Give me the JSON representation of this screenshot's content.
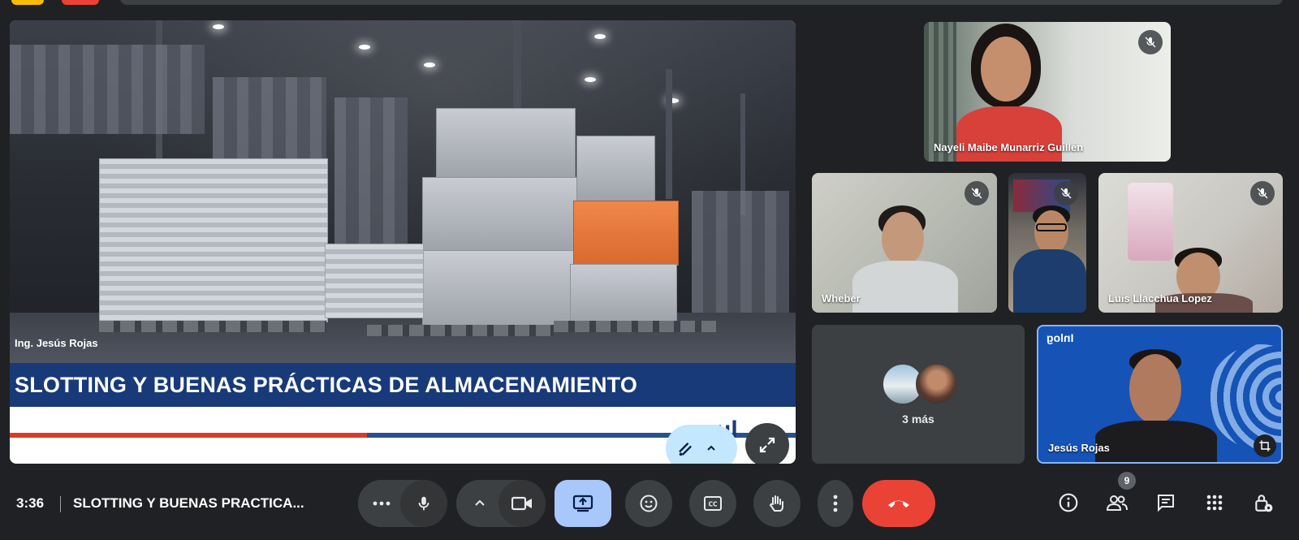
{
  "slide": {
    "presenter_caption": "Ing. Jesús Rojas",
    "title": "SLOTTING Y BUENAS PRÁCTICAS DE ALMACENAMIENTO"
  },
  "participants": [
    {
      "name": "Nayeli Maibe Munarriz Guillén",
      "muted": true
    },
    {
      "name": "Wheber",
      "muted": true
    },
    {
      "name": "",
      "muted": true
    },
    {
      "name": "Luis Llacchua Lopez",
      "muted": true
    },
    {
      "name": "Jesús Rojas",
      "muted": false
    }
  ],
  "overflow_tile": {
    "label": "3 más"
  },
  "jesus_tile": {
    "background_logo_text": "Inlog"
  },
  "bottom_bar": {
    "time": "3:36",
    "meeting_title": "SLOTTING Y BUENAS PRACTICA...",
    "people_count": "9"
  },
  "colors": {
    "accent_blue": "#a8c7fa",
    "end_call_red": "#ea4335",
    "slide_title_band": "#183a78"
  },
  "icons": [
    "more-options-icon",
    "microphone-icon",
    "chevron-up-icon",
    "camera-icon",
    "present-screen-icon",
    "emoji-icon",
    "captions-icon",
    "raise-hand-icon",
    "more-vert-icon",
    "end-call-icon",
    "info-icon",
    "people-icon",
    "chat-icon",
    "activities-icon",
    "host-controls-icon",
    "mic-off-icon",
    "fullscreen-icon",
    "annotate-icon",
    "crop-icon"
  ]
}
